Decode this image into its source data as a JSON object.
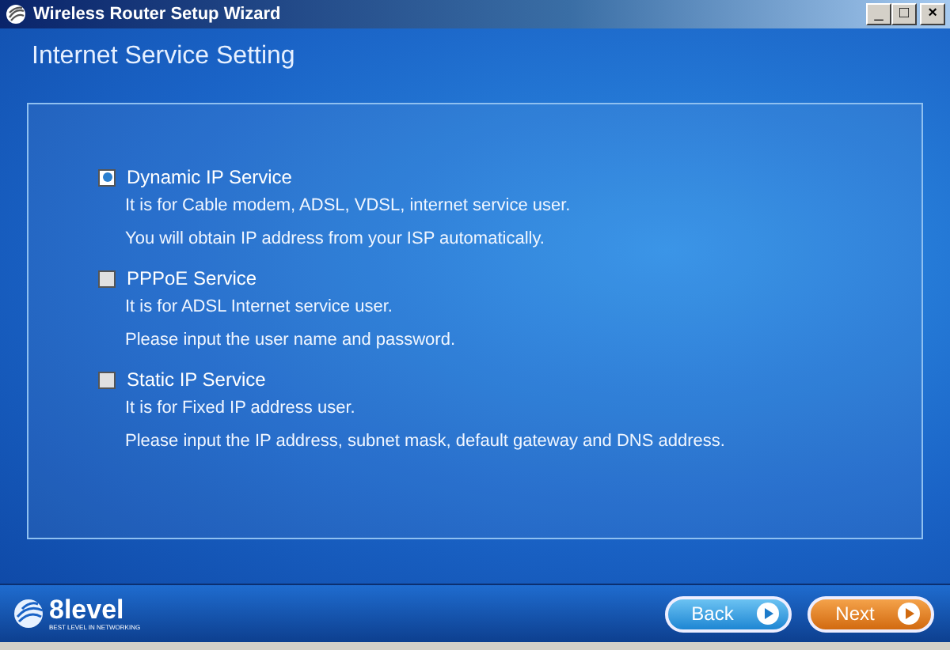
{
  "window": {
    "title": "Wireless Router Setup Wizard",
    "controls": [
      "_",
      "□",
      "×"
    ]
  },
  "heading": "Internet Service Setting",
  "options": [
    {
      "label": "Dynamic IP Service",
      "selected": true,
      "lines": [
        "It is for Cable modem, ADSL, VDSL, internet service user.",
        "You will obtain IP address from your ISP automatically."
      ]
    },
    {
      "label": "PPPoE Service",
      "selected": false,
      "lines": [
        "It is for ADSL Internet service user.",
        "Please input the user name and password."
      ]
    },
    {
      "label": "Static IP Service",
      "selected": false,
      "lines": [
        "It is for Fixed IP address user.",
        "Please input the IP address, subnet mask, default gateway and DNS address."
      ]
    }
  ],
  "logo": {
    "name": "8level",
    "tagline": "BEST LEVEL IN NETWORKING"
  },
  "buttons": [
    {
      "label": "Back",
      "kind": "back"
    },
    {
      "label": "Next",
      "kind": "next"
    }
  ]
}
